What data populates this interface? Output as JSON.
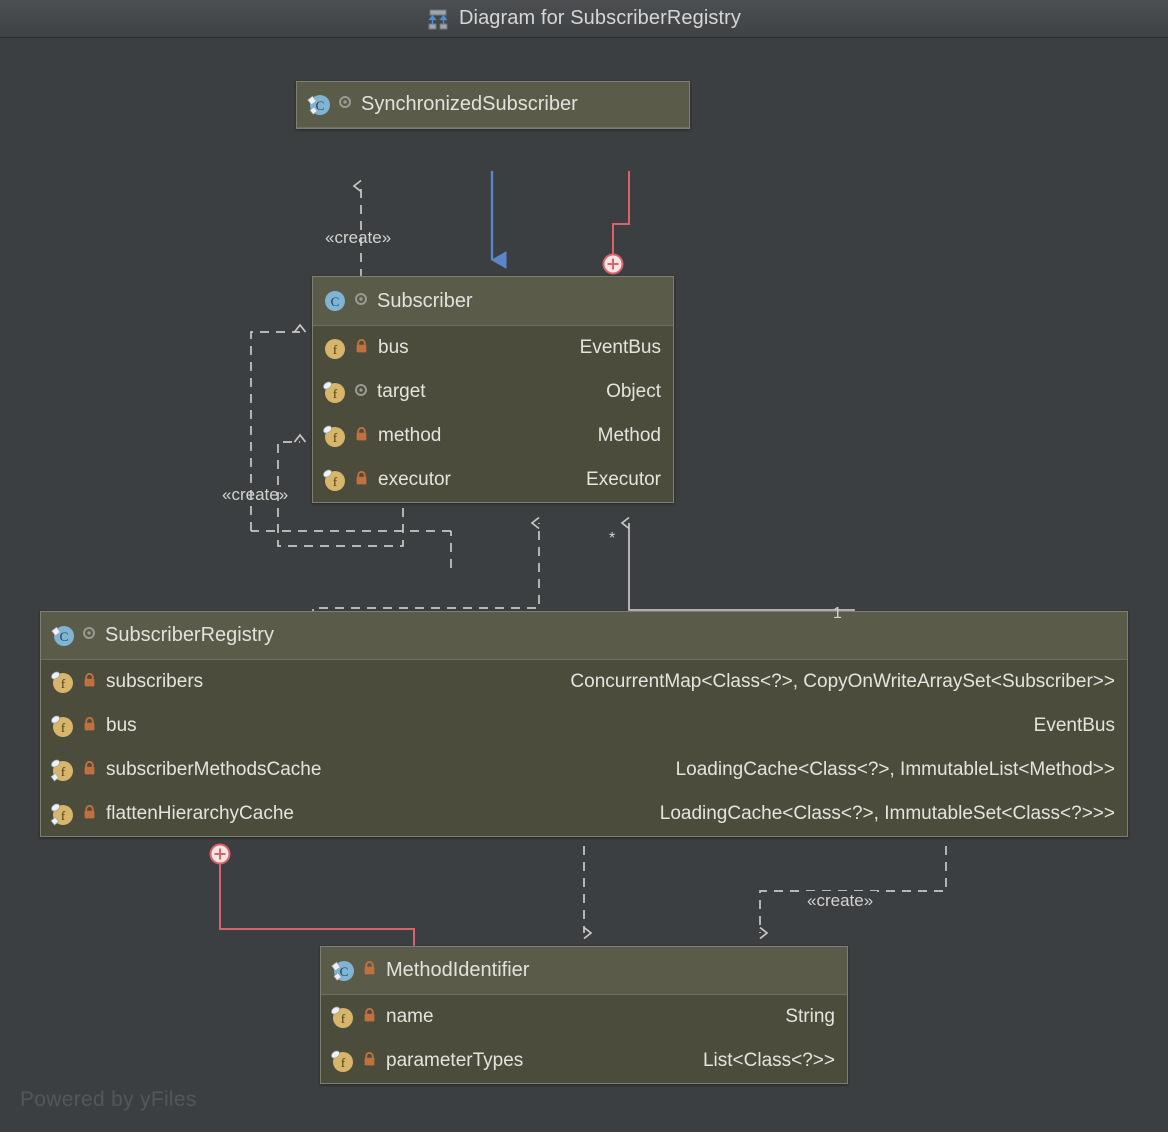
{
  "window": {
    "title": "Diagram for SubscriberRegistry",
    "title_icon": "diagram-icon"
  },
  "watermark": "Powered by yFiles",
  "colors": {
    "background": "#3c3f41",
    "class_header": "#5b5b4a",
    "class_body": "#4b4c3c",
    "class_border": "#7d7f73",
    "text": "#e4e4df",
    "edge_default": "#c8c8c4",
    "edge_generalization": "#5b87c9",
    "edge_inner_class": "#d9636b",
    "class_icon": "#7fb4d4",
    "field_icon": "#d7b56a",
    "lock_private": "#c2703f",
    "vis_package": "#9a9a93",
    "watermark": "#54575a"
  },
  "classes": [
    {
      "id": "synchronized-subscriber",
      "name": "SynchronizedSubscriber",
      "icon": "class-icon",
      "icon_final": true,
      "visibility_icon": "package-private-icon",
      "fields": []
    },
    {
      "id": "subscriber",
      "name": "Subscriber",
      "icon": "class-icon",
      "icon_final": false,
      "visibility_icon": "package-private-icon",
      "fields": [
        {
          "name": "bus",
          "type": "EventBus",
          "icon": "field-icon",
          "icon_final": false,
          "visibility_icon": "private-lock-icon"
        },
        {
          "name": "target",
          "type": "Object",
          "icon": "field-icon",
          "icon_final": true,
          "visibility_icon": "package-private-icon"
        },
        {
          "name": "method",
          "type": "Method",
          "icon": "field-icon",
          "icon_final": true,
          "visibility_icon": "private-lock-icon"
        },
        {
          "name": "executor",
          "type": "Executor",
          "icon": "field-icon",
          "icon_final": true,
          "visibility_icon": "private-lock-icon"
        }
      ]
    },
    {
      "id": "subscriber-registry",
      "name": "SubscriberRegistry",
      "icon": "class-icon",
      "icon_final": true,
      "visibility_icon": "package-private-icon",
      "fields": [
        {
          "name": "subscribers",
          "type": "ConcurrentMap<Class<?>, CopyOnWriteArraySet<Subscriber>>",
          "icon": "field-icon",
          "icon_final": true,
          "visibility_icon": "private-lock-icon"
        },
        {
          "name": "bus",
          "type": "EventBus",
          "icon": "field-icon",
          "icon_final": true,
          "visibility_icon": "private-lock-icon"
        },
        {
          "name": "subscriberMethodsCache",
          "type": "LoadingCache<Class<?>, ImmutableList<Method>>",
          "icon": "field-icon",
          "icon_final": true,
          "visibility_icon": "private-lock-icon"
        },
        {
          "name": "flattenHierarchyCache",
          "type": "LoadingCache<Class<?>, ImmutableSet<Class<?>>>",
          "icon": "field-icon",
          "icon_final": true,
          "visibility_icon": "private-lock-icon"
        }
      ]
    },
    {
      "id": "method-identifier",
      "name": "MethodIdentifier",
      "icon": "class-icon",
      "icon_final": true,
      "visibility_icon": "private-lock-icon",
      "fields": [
        {
          "name": "name",
          "type": "String",
          "icon": "field-icon",
          "icon_final": true,
          "visibility_icon": "private-lock-icon"
        },
        {
          "name": "parameterTypes",
          "type": "List<Class<?>>",
          "icon": "field-icon",
          "icon_final": true,
          "visibility_icon": "private-lock-icon"
        }
      ]
    }
  ],
  "edge_labels": {
    "create_top": "«create»",
    "create_left": "«create»",
    "create_bottom": "«create»",
    "mult_many": "*",
    "mult_one": "1"
  }
}
